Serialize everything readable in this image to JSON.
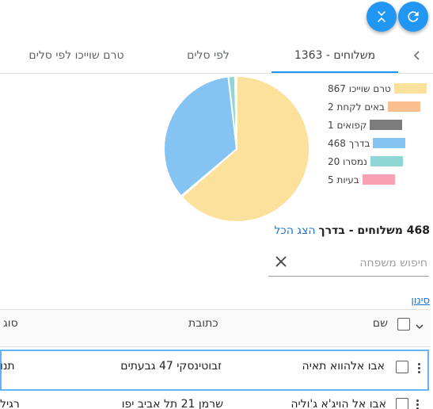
{
  "actions": {
    "refresh_icon": "refresh-icon",
    "collapse_icon": "collapse-icon"
  },
  "tabs": [
    {
      "label": "משלוחים - 1363",
      "active": true
    },
    {
      "label": "לפי סלים",
      "active": false
    },
    {
      "label": "טרם שוייכו לפי סלים",
      "active": false
    }
  ],
  "chart_data": {
    "type": "pie",
    "series": [
      {
        "label": "טרם שוייכו 867",
        "value": 867,
        "color": "#fbe19b"
      },
      {
        "label": "באים לקחת 2",
        "value": 2,
        "color": "#f9c08f"
      },
      {
        "label": "קפואים 1",
        "value": 1,
        "color": "#7b7b7b"
      },
      {
        "label": "בדרך 468",
        "value": 468,
        "color": "#84c3f2"
      },
      {
        "label": "נמסרו 20",
        "value": 20,
        "color": "#8fd7d5"
      },
      {
        "label": "בעיות 5",
        "value": 5,
        "color": "#f9a1b3"
      }
    ],
    "legend_placement": "right"
  },
  "summary": {
    "count_text": "468 משלוחים - בדרך",
    "separator": " - ",
    "show_all": "הצג הכל"
  },
  "search": {
    "placeholder": "חיפוש משפחה",
    "value": ""
  },
  "filter_link": "סינון",
  "table": {
    "headers": {
      "name": "שם",
      "address": "כתובת",
      "type": "סוג"
    },
    "rows": [
      {
        "name": "אבו אלהווא תאיה",
        "address": "זבוטינסקי 47 גבעתים",
        "type": "תנו"
      },
      {
        "name": "אבו אל הויג'א ג'וליה",
        "address": "שרמן 21 תל אביב יפו",
        "type": "רגיל"
      }
    ]
  }
}
